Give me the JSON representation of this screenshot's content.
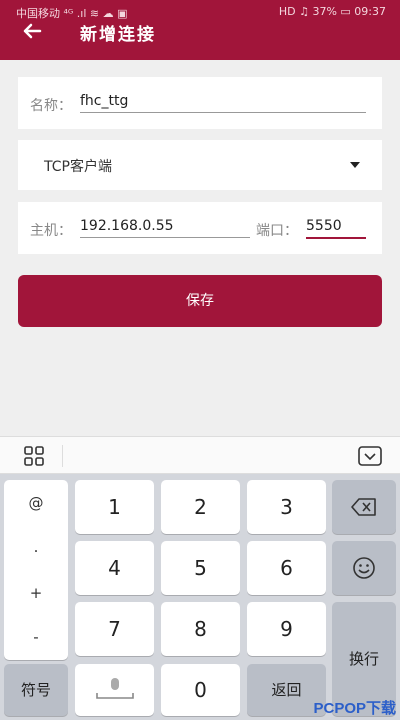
{
  "status": {
    "carrier": "中国移动 ⁴ᴳ .ıl ≋ ☁ ▣",
    "right": "HD ♫ 37% ▭ 09:37"
  },
  "header": {
    "title": "新增连接"
  },
  "form": {
    "name_label": "名称：",
    "name_value": "fhc_ttg",
    "type_value": "TCP客户端",
    "host_label": "主机：",
    "host_value": "192.168.0.55",
    "port_label": "端口：",
    "port_value": "5550",
    "save_label": "保存"
  },
  "keyboard": {
    "symbols": [
      "@",
      ".",
      "+",
      "-"
    ],
    "digits": [
      "1",
      "2",
      "3",
      "4",
      "5",
      "6",
      "7",
      "8",
      "9",
      "0"
    ],
    "fuhao": "符号",
    "enter": "换行",
    "back": "返回"
  },
  "watermark": "PCPOP下载"
}
